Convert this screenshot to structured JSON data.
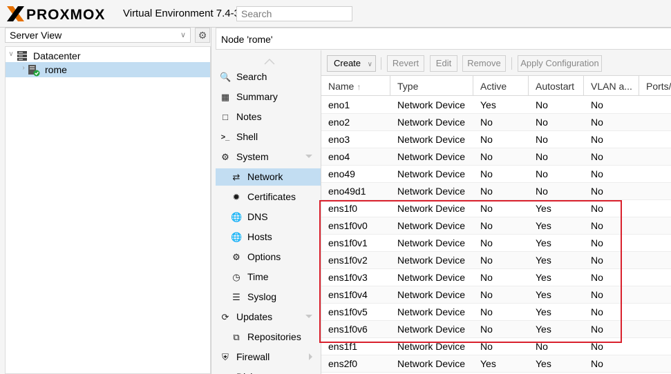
{
  "header": {
    "logo_text": "PROXMOX",
    "product": "Virtual Environment 7.4-3",
    "search_placeholder": "Search"
  },
  "tree_panel": {
    "view_select": "Server View",
    "nodes": [
      {
        "label": "Datacenter",
        "icon": "datacenter-icon",
        "selected": false
      },
      {
        "label": "rome",
        "icon": "server-online-icon",
        "selected": true
      }
    ]
  },
  "node_title": "Node 'rome'",
  "side_menu": [
    {
      "label": "Search",
      "icon": "search-icon",
      "indent": false,
      "active": false
    },
    {
      "label": "Summary",
      "icon": "book-icon",
      "indent": false,
      "active": false
    },
    {
      "label": "Notes",
      "icon": "notes-icon",
      "indent": false,
      "active": false
    },
    {
      "label": "Shell",
      "icon": "terminal-icon",
      "indent": false,
      "active": false
    },
    {
      "label": "System",
      "icon": "gears-icon",
      "indent": false,
      "active": false,
      "caret": "down"
    },
    {
      "label": "Network",
      "icon": "network-icon",
      "indent": true,
      "active": true
    },
    {
      "label": "Certificates",
      "icon": "certificate-icon",
      "indent": true,
      "active": false
    },
    {
      "label": "DNS",
      "icon": "globe-icon",
      "indent": true,
      "active": false
    },
    {
      "label": "Hosts",
      "icon": "globe-icon",
      "indent": true,
      "active": false
    },
    {
      "label": "Options",
      "icon": "gear-icon",
      "indent": true,
      "active": false
    },
    {
      "label": "Time",
      "icon": "clock-icon",
      "indent": true,
      "active": false
    },
    {
      "label": "Syslog",
      "icon": "list-icon",
      "indent": true,
      "active": false
    },
    {
      "label": "Updates",
      "icon": "refresh-icon",
      "indent": false,
      "active": false,
      "caret": "down"
    },
    {
      "label": "Repositories",
      "icon": "copy-icon",
      "indent": true,
      "active": false
    },
    {
      "label": "Firewall",
      "icon": "shield-icon",
      "indent": false,
      "active": false,
      "caret": "right"
    },
    {
      "label": "Disks",
      "icon": "disk-icon",
      "indent": false,
      "active": false
    }
  ],
  "toolbar": {
    "create": "Create",
    "revert": "Revert",
    "edit": "Edit",
    "remove": "Remove",
    "apply": "Apply Configuration"
  },
  "grid": {
    "columns": [
      "Name",
      "Type",
      "Active",
      "Autostart",
      "VLAN a...",
      "Ports/S"
    ],
    "rows": [
      [
        "eno1",
        "Network Device",
        "Yes",
        "No",
        "No"
      ],
      [
        "eno2",
        "Network Device",
        "No",
        "No",
        "No"
      ],
      [
        "eno3",
        "Network Device",
        "No",
        "No",
        "No"
      ],
      [
        "eno4",
        "Network Device",
        "No",
        "No",
        "No"
      ],
      [
        "eno49",
        "Network Device",
        "No",
        "No",
        "No"
      ],
      [
        "eno49d1",
        "Network Device",
        "No",
        "No",
        "No"
      ],
      [
        "ens1f0",
        "Network Device",
        "No",
        "Yes",
        "No"
      ],
      [
        "ens1f0v0",
        "Network Device",
        "No",
        "Yes",
        "No"
      ],
      [
        "ens1f0v1",
        "Network Device",
        "No",
        "Yes",
        "No"
      ],
      [
        "ens1f0v2",
        "Network Device",
        "No",
        "Yes",
        "No"
      ],
      [
        "ens1f0v3",
        "Network Device",
        "No",
        "Yes",
        "No"
      ],
      [
        "ens1f0v4",
        "Network Device",
        "No",
        "Yes",
        "No"
      ],
      [
        "ens1f0v5",
        "Network Device",
        "No",
        "Yes",
        "No"
      ],
      [
        "ens1f0v6",
        "Network Device",
        "No",
        "Yes",
        "No"
      ],
      [
        "ens1f1",
        "Network Device",
        "No",
        "No",
        "No"
      ],
      [
        "ens2f0",
        "Network Device",
        "Yes",
        "Yes",
        "No"
      ]
    ]
  },
  "colors": {
    "selection": "#c2ddf2",
    "logo_orange": "#e57000",
    "highlight": "#d9202c"
  }
}
